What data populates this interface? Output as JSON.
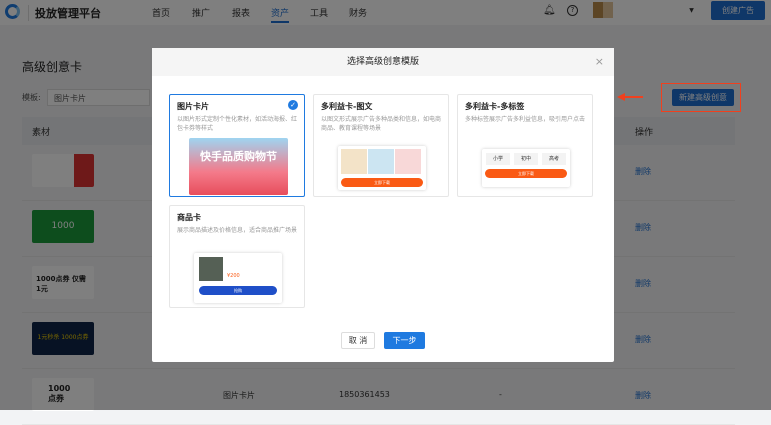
{
  "header": {
    "brand": "投放管理平台",
    "nav": [
      "首页",
      "推广",
      "报表",
      "资产",
      "工具",
      "财务"
    ],
    "active_nav": "资产",
    "create_ad": "创建广告"
  },
  "page": {
    "title": "高级创意卡",
    "template_label": "模板:",
    "template_value": "图片卡片",
    "new_button": "新建高级创意",
    "columns": {
      "material": "素材",
      "action": "操作"
    },
    "rows": [
      {
        "action": "删除"
      },
      {
        "action": "删除"
      },
      {
        "action": "删除"
      },
      {
        "action": "删除"
      },
      {
        "type": "图片卡片",
        "id": "1850361453",
        "extra": "-",
        "action": "删除"
      }
    ],
    "thumb_texts": [
      "1000点券",
      "1000点券 仅需1元",
      "1元秒杀 1000点券"
    ]
  },
  "modal": {
    "title": "选择高级创意模版",
    "close": "×",
    "cards": [
      {
        "title": "图片卡片",
        "desc": "以图片形式定制个性化素材，如活动海报、红包卡券等样式",
        "selected": true,
        "preview_text": "快手品质购物节"
      },
      {
        "title": "多利益卡-图文",
        "desc": "以图文形式展示广告多种品类和信息，如电商商品、教育课程等场景",
        "selected": false,
        "button": "立即下载"
      },
      {
        "title": "多利益卡-多标签",
        "desc": "多种标签展示广告多利益信息，吸引用户点击",
        "selected": false,
        "tags": [
          "小学",
          "初中",
          "高考"
        ],
        "button": "立即下载"
      },
      {
        "title": "商品卡",
        "desc": "展示商品描述及价格信息，适合商品推广场景",
        "selected": false,
        "price": "¥200",
        "button": "抢购"
      }
    ],
    "cancel": "取 消",
    "next": "下一步"
  },
  "colors": {
    "primary": "#1f7ae0",
    "annotation": "#f0401e"
  }
}
